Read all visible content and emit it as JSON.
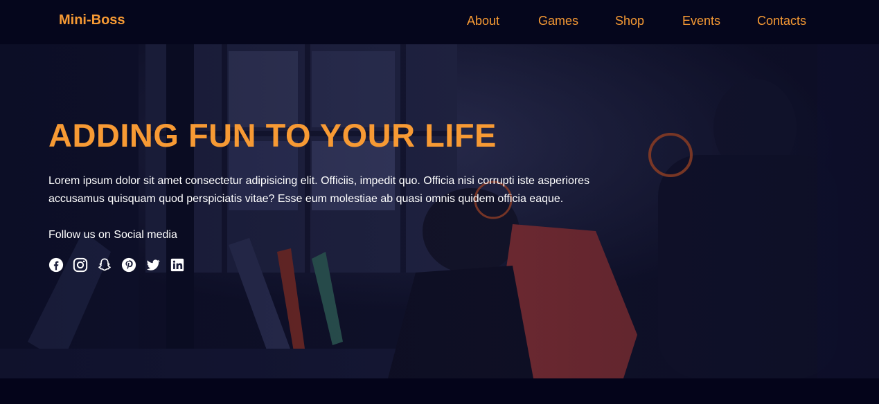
{
  "nav": {
    "brand": "Mini-Boss",
    "links": [
      {
        "label": "About"
      },
      {
        "label": "Games"
      },
      {
        "label": "Shop"
      },
      {
        "label": "Events"
      },
      {
        "label": "Contacts"
      }
    ]
  },
  "hero": {
    "title": "ADDING FUN TO YOUR LIFE",
    "text": "Lorem ipsum dolor sit amet consectetur adipisicing elit. Officiis, impedit quo. Officia nisi corrupti iste asperiores accusamus quisquam quod perspiciatis vitae? Esse eum molestiae ab quasi omnis quidem officia eaque.",
    "follow_label": "Follow us on Social media",
    "socials": [
      "facebook-icon",
      "instagram-icon",
      "snapchat-icon",
      "pinterest-icon",
      "twitter-icon",
      "linkedin-icon"
    ],
    "background_image": "photo of gamers playing at computers in a dark room"
  },
  "colors": {
    "accent": "#f79a34",
    "nav_background": "#05061c",
    "page_background": "#04041a",
    "text": "#ffffff"
  }
}
